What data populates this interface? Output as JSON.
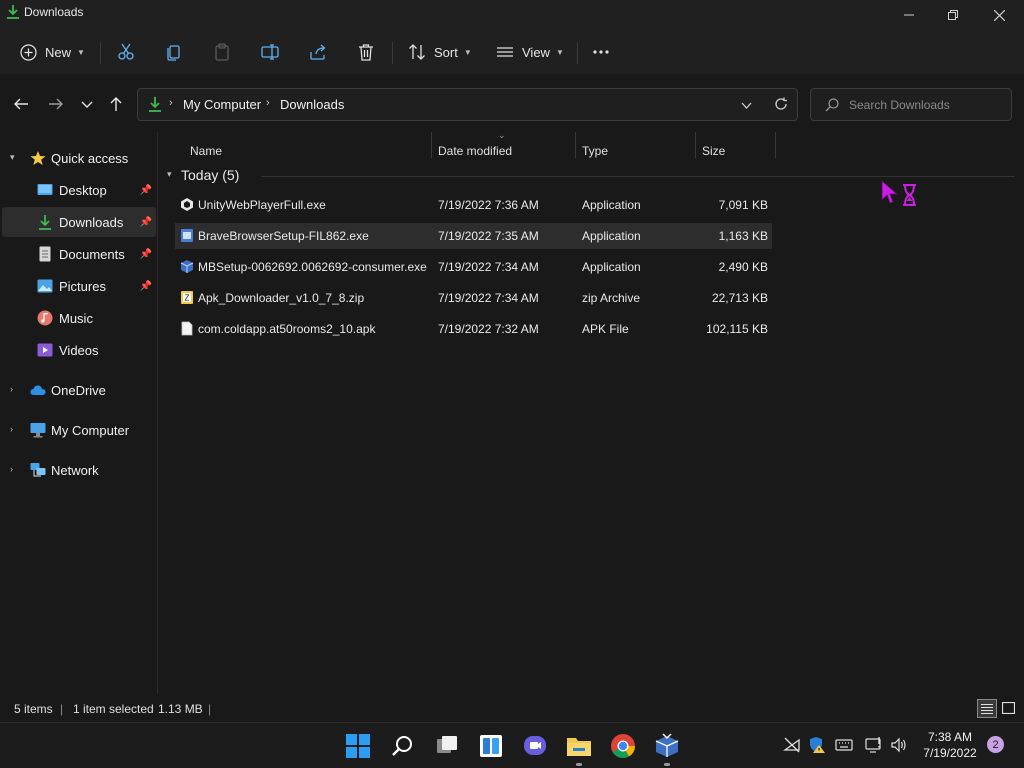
{
  "window": {
    "title": "Downloads"
  },
  "toolbar": {
    "new_label": "New",
    "sort_label": "Sort",
    "view_label": "View"
  },
  "address": {
    "segments": [
      "My Computer",
      "Downloads"
    ]
  },
  "search": {
    "placeholder": "Search Downloads"
  },
  "sidebar": {
    "items": [
      {
        "label": "Quick access"
      },
      {
        "label": "Desktop"
      },
      {
        "label": "Downloads"
      },
      {
        "label": "Documents"
      },
      {
        "label": "Pictures"
      },
      {
        "label": "Music"
      },
      {
        "label": "Videos"
      },
      {
        "label": "OneDrive"
      },
      {
        "label": "My Computer"
      },
      {
        "label": "Network"
      }
    ]
  },
  "list": {
    "columns": {
      "name": "Name",
      "date": "Date modified",
      "type": "Type",
      "size": "Size"
    },
    "group_label": "Today (5)",
    "files": [
      {
        "name": "UnityWebPlayerFull.exe",
        "date": "7/19/2022 7:36 AM",
        "type": "Application",
        "size": "7,091 KB"
      },
      {
        "name": "BraveBrowserSetup-FIL862.exe",
        "date": "7/19/2022 7:35 AM",
        "type": "Application",
        "size": "1,163 KB"
      },
      {
        "name": "MBSetup-0062692.0062692-consumer.exe",
        "date": "7/19/2022 7:34 AM",
        "type": "Application",
        "size": "2,490 KB"
      },
      {
        "name": "Apk_Downloader_v1.0_7_8.zip",
        "date": "7/19/2022 7:34 AM",
        "type": "zip Archive",
        "size": "22,713 KB"
      },
      {
        "name": "com.coldapp.at50rooms2_10.apk",
        "date": "7/19/2022 7:32 AM",
        "type": "APK File",
        "size": "102,115 KB"
      }
    ]
  },
  "status": {
    "items_count": "5 items",
    "selection": "1 item selected",
    "selection_size": "1.13 MB"
  },
  "clock": {
    "time": "7:38 AM",
    "date": "7/19/2022"
  },
  "notifications": {
    "count": "2"
  },
  "colors": {
    "background": "#191919",
    "selection": "#2d2d2d",
    "accent_green": "#3fb950",
    "folder_yellow": "#f2c94c",
    "cursor": "#c81fe0"
  }
}
